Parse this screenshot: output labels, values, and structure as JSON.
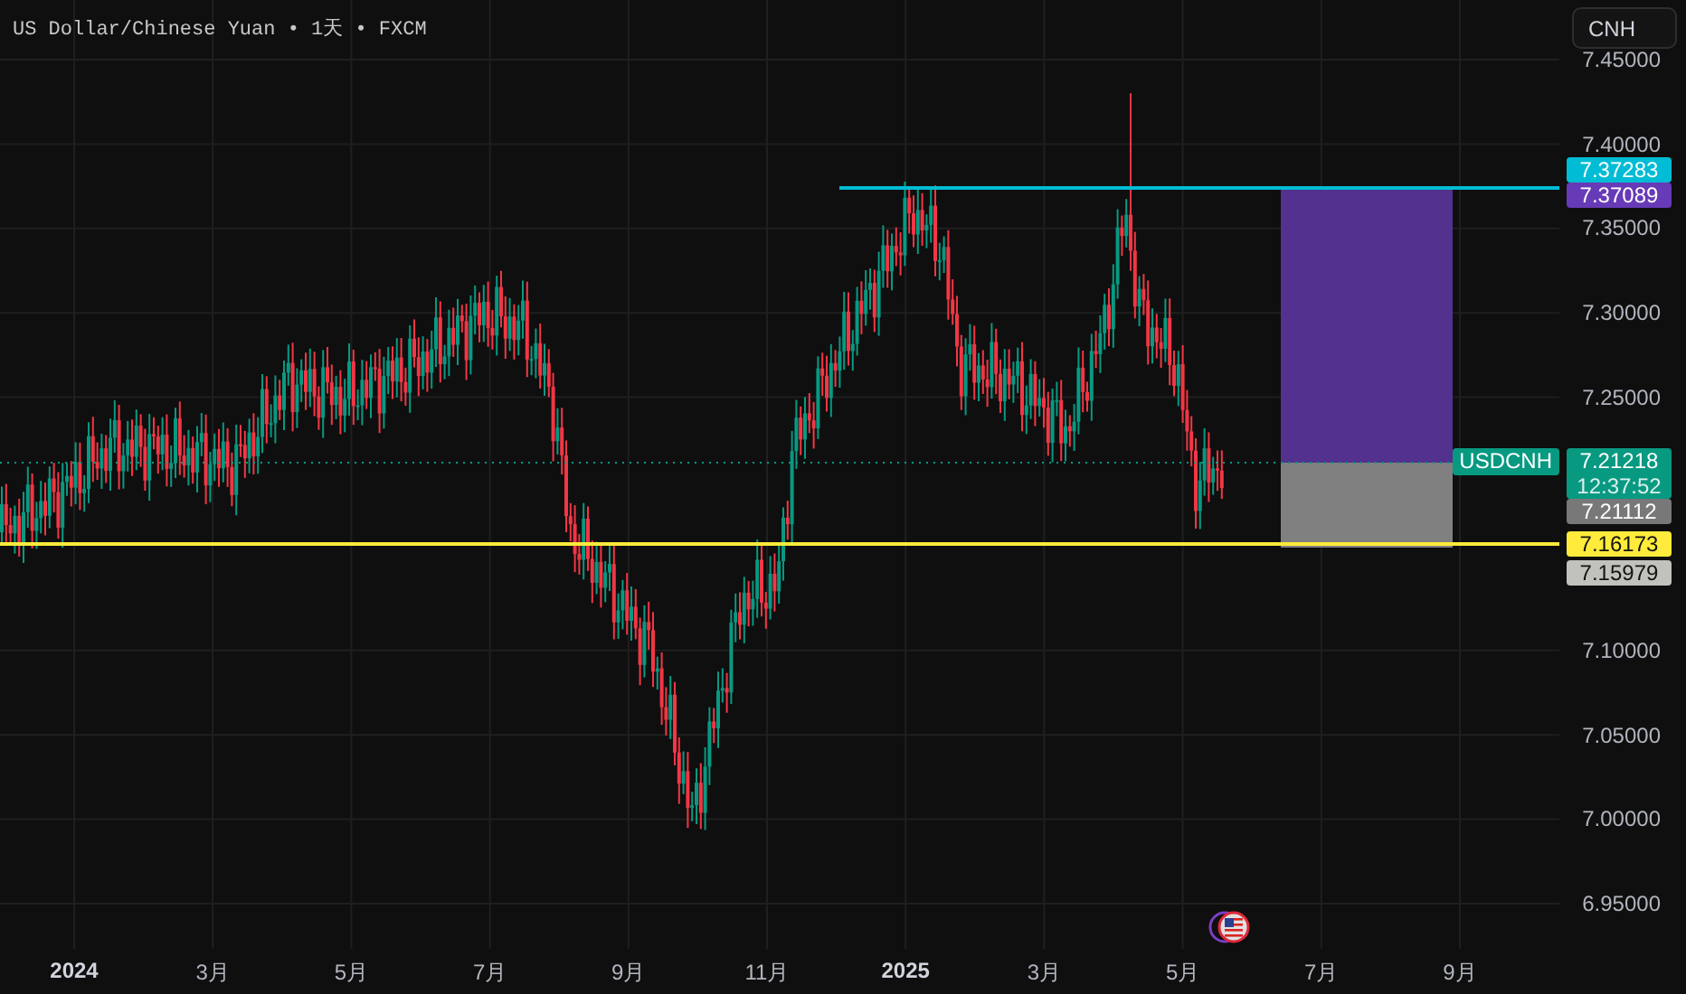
{
  "title": "US Dollar/Chinese Yuan • 1天 • FXCM",
  "currency_button": "CNH",
  "price_ticks": [
    "7.45000",
    "7.40000",
    "7.35000",
    "7.30000",
    "7.25000",
    "7.10000",
    "7.05000",
    "7.00000",
    "6.95000"
  ],
  "price_labels": [
    {
      "text": "7.37283",
      "color": "#00bcd4"
    },
    {
      "text": "7.37089",
      "color": "#673ab7"
    },
    {
      "symbol": "USDCNH",
      "text": "7.21218",
      "countdown": "12:37:52",
      "color": "#089981"
    },
    {
      "text": "7.21112",
      "color": "#787878"
    },
    {
      "text": "7.16173",
      "color": "#ffeb3b"
    },
    {
      "text": "7.15979",
      "color": "#c2c2bd"
    }
  ],
  "time_labels": [
    {
      "text": "2024",
      "kind": "year"
    },
    {
      "text": "3月",
      "kind": "month"
    },
    {
      "text": "5月",
      "kind": "month"
    },
    {
      "text": "7月",
      "kind": "month"
    },
    {
      "text": "9月",
      "kind": "month"
    },
    {
      "text": "11月",
      "kind": "month"
    },
    {
      "text": "2025",
      "kind": "year"
    },
    {
      "text": "3月",
      "kind": "month"
    },
    {
      "text": "5月",
      "kind": "month"
    },
    {
      "text": "7月",
      "kind": "month"
    },
    {
      "text": "9月",
      "kind": "month"
    }
  ]
}
